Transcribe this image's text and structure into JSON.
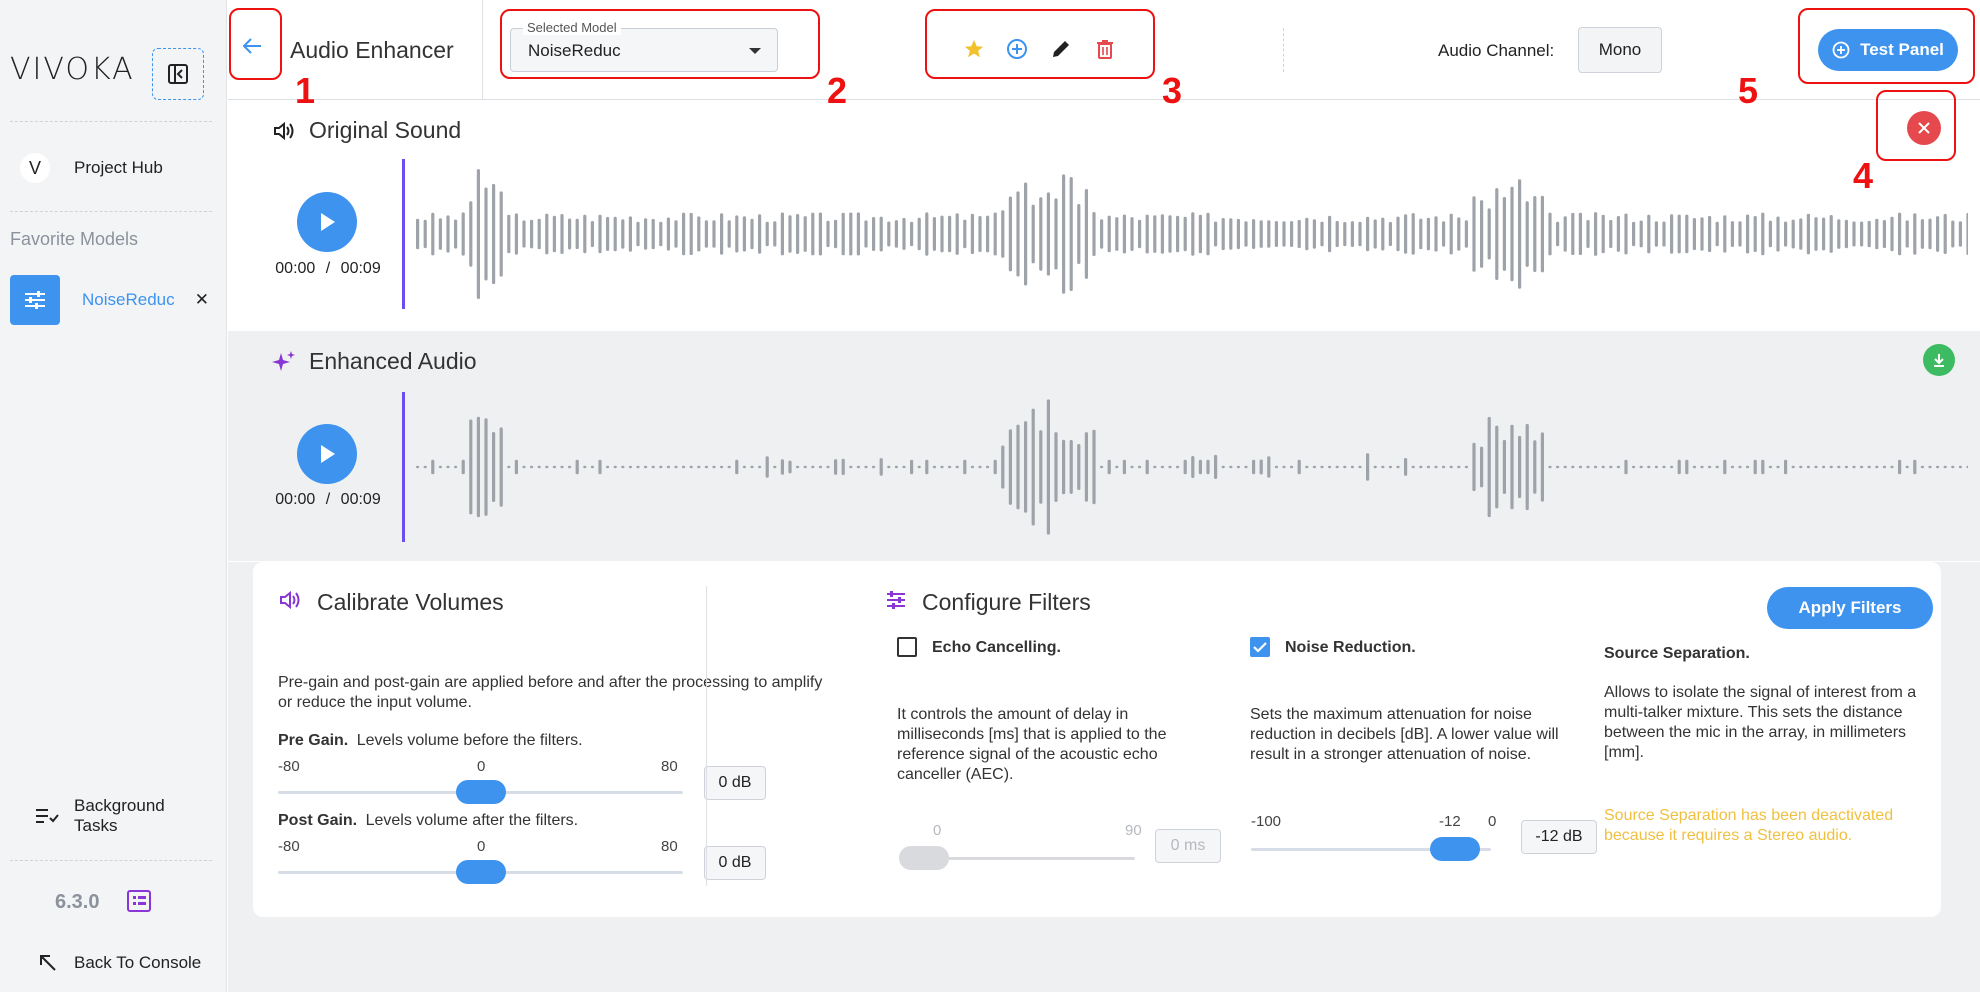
{
  "sidebar": {
    "logo": "VIVOKA",
    "project_hub": "Project Hub",
    "favorites_heading": "Favorite Models",
    "favorite_item": "NoiseReduc",
    "favorite_close": "✕",
    "background_tasks_line1": "Background",
    "background_tasks_line2": "Tasks",
    "version": "6.3.0",
    "back_to_console": "Back To Console"
  },
  "header": {
    "title": "Audio Enhancer",
    "selected_model_label": "Selected Model",
    "selected_model_value": "NoiseReduc",
    "audio_channel_label": "Audio Channel:",
    "audio_channel_value": "Mono",
    "test_panel_label": "Test Panel"
  },
  "annotations": [
    "1",
    "2",
    "3",
    "4",
    "5"
  ],
  "original": {
    "title": "Original Sound",
    "time_current": "00:00",
    "time_sep": "/",
    "time_total": "00:09"
  },
  "enhanced": {
    "title": "Enhanced Audio",
    "time_current": "00:00",
    "time_sep": "/",
    "time_total": "00:09"
  },
  "calibrate": {
    "title": "Calibrate Volumes",
    "description": "Pre-gain and post-gain are applied before and after the processing to amplify or reduce the input volume.",
    "pre_gain_label": "Pre Gain.",
    "pre_gain_desc": "Levels volume before the filters.",
    "pre_min": "-80",
    "pre_mid": "0",
    "pre_max": "80",
    "pre_value": "0 dB",
    "post_gain_label": "Post Gain.",
    "post_gain_desc": "Levels volume after the filters.",
    "post_min": "-80",
    "post_mid": "0",
    "post_max": "80",
    "post_value": "0 dB",
    "pre_fraction": 0.5,
    "post_fraction": 0.5
  },
  "filters": {
    "title": "Configure Filters",
    "apply_label": "Apply Filters",
    "echo": {
      "label": "Echo Cancelling.",
      "checked": false,
      "description": "It controls the amount of delay in milliseconds [ms] that is applied to the reference signal of the acoustic echo canceller (AEC).",
      "min": "0",
      "max": "90",
      "value": "0 ms",
      "fraction": 0
    },
    "noise": {
      "label": "Noise Reduction.",
      "checked": true,
      "description": "Sets the maximum attenuation for noise reduction in decibels [dB]. A lower value will result in a stronger attenuation of noise.",
      "min": "-100",
      "mid": "-12",
      "max": "0",
      "value": "-12 dB",
      "fraction": 0.88
    },
    "source": {
      "label": "Source Separation.",
      "description": "Allows to isolate the signal of interest from a multi-talker mixture. This sets the distance between the mic in the array, in millimeters [mm].",
      "warning": "Source Separation has been deactivated because it requires a Stereo audio."
    }
  },
  "colors": {
    "accent": "#3d93ee",
    "annotation_red": "#e11111",
    "warning": "#f0c040",
    "download_green": "#3dbb62",
    "close_red": "#e5484d",
    "purple": "#8a35d6"
  }
}
